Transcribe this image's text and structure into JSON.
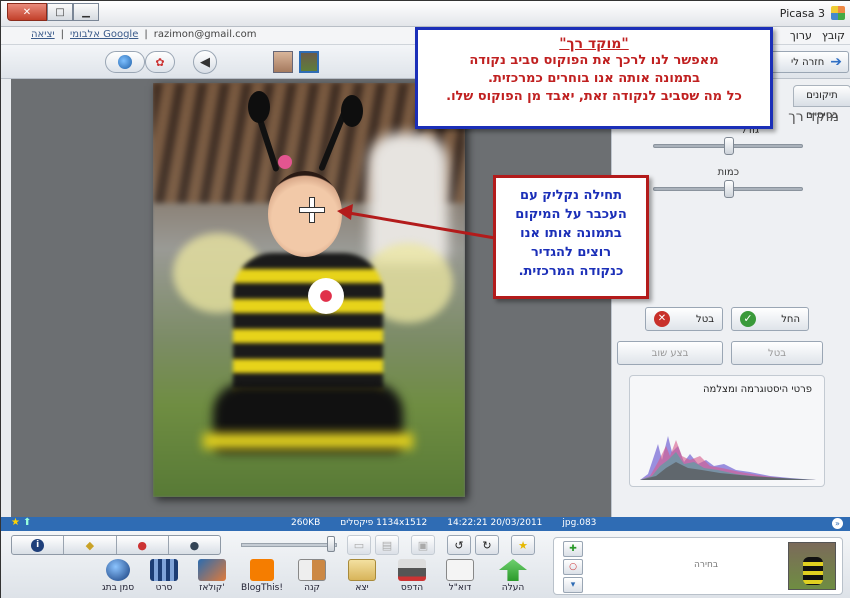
{
  "window": {
    "app_title": "Picasa 3",
    "buttons": {
      "minimize": "▁",
      "maximize": "□",
      "close": "✕"
    }
  },
  "menubar": {
    "menus": [
      "קובץ",
      "ערוך"
    ],
    "email": "razimon@gmail.com",
    "account_link": "אלבומי Google",
    "exit_link": "יציאה"
  },
  "toolbar": {
    "back_to_library": "חזרה לי"
  },
  "panel": {
    "tab_label": "תיקונים בסיסיים",
    "title": "מוקד רך",
    "size_label": "גודל",
    "amount_label": "כמות",
    "apply_label": "החל",
    "cancel_label": "בטל",
    "cancel2_label": "בטל",
    "redo_label": "בצע שוב",
    "histogram_title": "פרטי היסטוגרמה ומצלמה"
  },
  "slider_values": {
    "size": 0.5,
    "amount": 0.5
  },
  "status": {
    "filename": "083.jpg",
    "datetime": "20/03/2011 14:22:21",
    "dimensions": "1134x1512 פיקסלים",
    "filesize": "260KB"
  },
  "tray": {
    "selection_label": "בחירה",
    "tools": [
      "העלה",
      "דוא\"ל",
      "הדפס",
      "יצא",
      "קנה",
      "BlogThis!",
      "קולאז'",
      "סרט",
      "סמן בתג"
    ]
  },
  "callouts": {
    "main_title": "\"מוקד רך\"",
    "main_lines": [
      "מאפשר לנו לרכך את הפוקוס סביב נקודה",
      "בתמונה אותה אנו בוחרים כמרכזית.",
      "כל מה שסביב לנקודה זאת, יאבד מן הפוקוס שלו."
    ],
    "tip_lines": [
      "תחילה נקליק עם",
      "העכבר על המיקום",
      "בתמונה אותו אנו",
      "רוצים להגדיר",
      "כנקודה המרכזית."
    ]
  },
  "colors": {
    "accent_blue": "#2f6cb4",
    "callout_blue_border": "#1b2fb8",
    "callout_red_border": "#b31b1b",
    "callout_text_red": "#c02020"
  }
}
